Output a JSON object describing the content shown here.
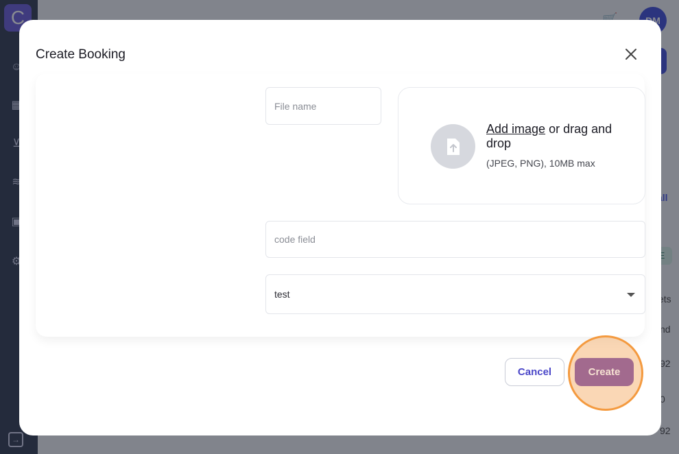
{
  "modal": {
    "title": "Create Booking",
    "file_name_placeholder": "File name",
    "dropzone": {
      "link_text": "Add image",
      "rest_text": " or drag and drop",
      "hint": "(JPEG, PNG), 10MB max"
    },
    "code_placeholder": "code field",
    "select_value": "test",
    "cancel_label": "Cancel",
    "create_label": "Create"
  },
  "background": {
    "avatar_initials": "DM",
    "logo_letter": "C",
    "partial_texts": [
      "all",
      "E",
      "ets",
      "nd",
      "92",
      "0",
      "92"
    ]
  },
  "colors": {
    "accent": "#4a46c8",
    "create_button": "#a26a8e",
    "highlight": "#f49a3f"
  }
}
